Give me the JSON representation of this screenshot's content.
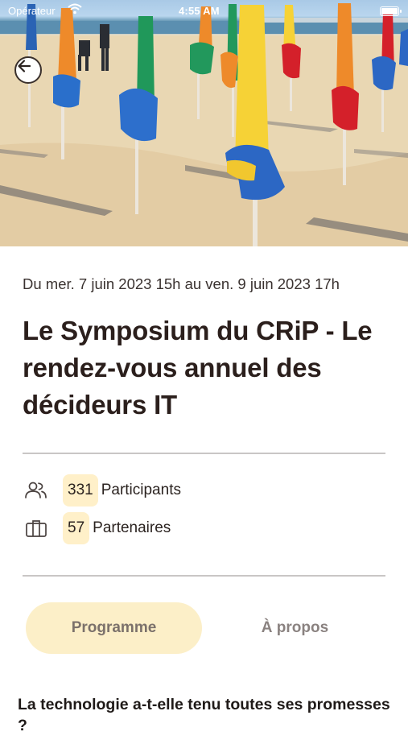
{
  "status_bar": {
    "carrier": "Opérateur",
    "time": "4:55 AM"
  },
  "hero": {
    "back_icon": "arrow-left-icon"
  },
  "event": {
    "date": "Du mer. 7 juin 2023 15h au ven. 9 juin 2023 17h",
    "title": "Le Symposium du CRiP - Le rendez-vous annuel des décideurs IT"
  },
  "stats": {
    "participants": {
      "count": "331",
      "label": "Participants",
      "icon": "people-icon"
    },
    "partners": {
      "count": "57",
      "label": "Partenaires",
      "icon": "briefcase-icon"
    }
  },
  "tabs": [
    {
      "label": "Programme",
      "active": true
    },
    {
      "label": "À propos",
      "active": false
    }
  ],
  "section": {
    "title": "La technologie a-t-elle tenu toutes ses promesses ?"
  },
  "colors": {
    "accent_soft": "#fcefc8",
    "badge_bg": "#fff0c9",
    "text_dark": "#2b1f1c",
    "divider": "#c9c6c5"
  }
}
